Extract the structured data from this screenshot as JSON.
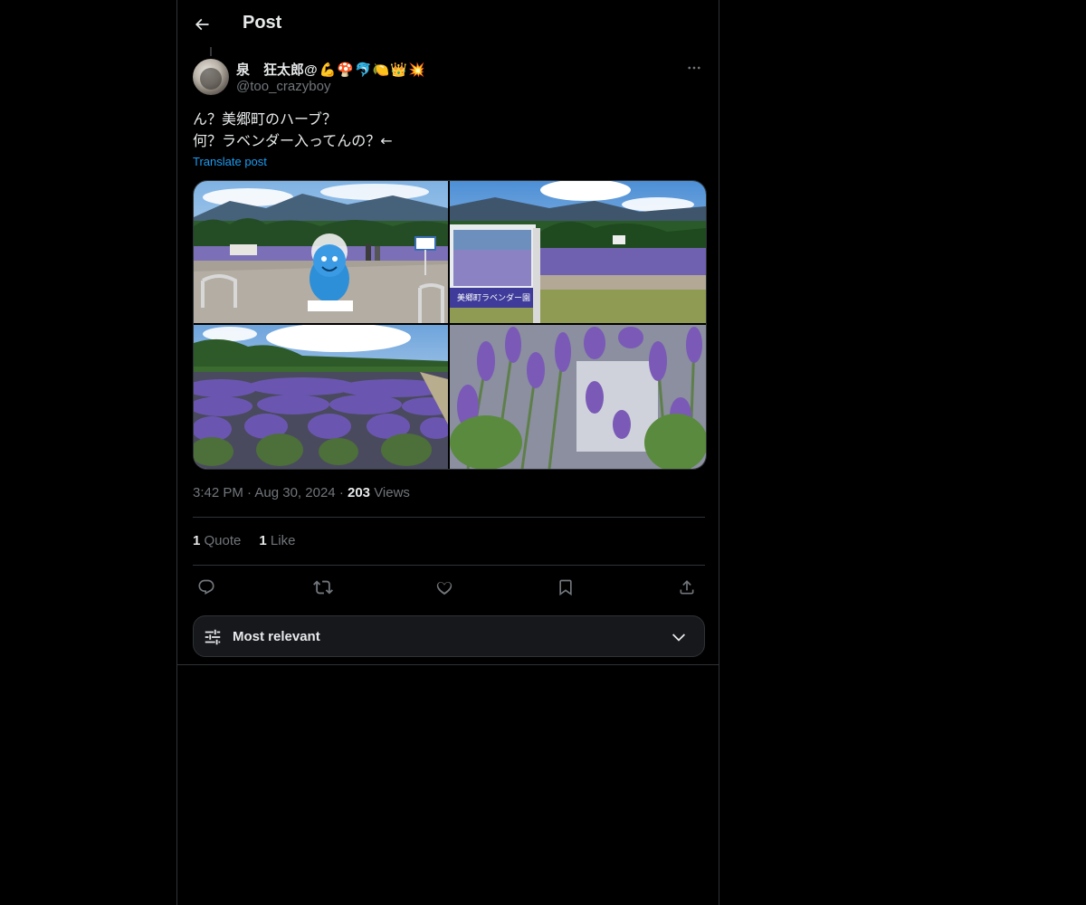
{
  "header": {
    "title": "Post"
  },
  "author": {
    "display_name": "泉　狂太郎@",
    "emojis": [
      "💪",
      "🍄",
      "🐬",
      "🍋",
      "👑",
      "💥"
    ],
    "handle": "@too_crazyboy"
  },
  "post": {
    "lines": [
      "ん？美郷町のハーブ？",
      "何？ラベンダー入ってんの？←"
    ],
    "translate_label": "Translate post",
    "sign_text": "美郷町ラベンダー園"
  },
  "meta": {
    "time": "3:42 PM",
    "date": "Aug 30, 2024",
    "views_count": "203",
    "views_label": "Views",
    "separator": "·"
  },
  "stats": {
    "quotes_count": "1",
    "quotes_label": "Quote",
    "likes_count": "1",
    "likes_label": "Like"
  },
  "sort": {
    "label": "Most relevant"
  },
  "colors": {
    "link": "#1d9bf0",
    "muted": "#71767b",
    "text": "#e7e9ea",
    "border": "#2f3336"
  }
}
